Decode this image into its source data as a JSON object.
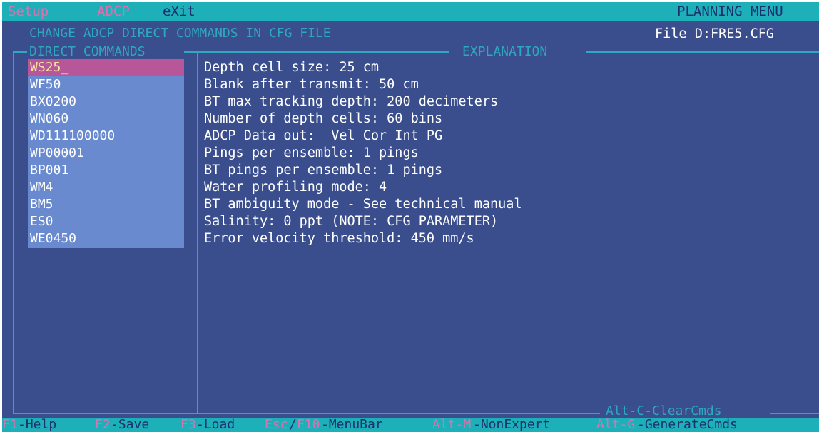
{
  "menu": {
    "setup": "Setup",
    "adcp": "ADCP",
    "exit": "eXit",
    "right_title": "PLANNING MENU"
  },
  "header": {
    "title": "CHANGE ADCP DIRECT COMMANDS IN CFG FILE",
    "file": "File D:FRE5.CFG"
  },
  "panels": {
    "commands_title": "DIRECT COMMANDS",
    "explanation_title": "EXPLANATION",
    "clear_label": "Alt-C-ClearCmds"
  },
  "commands": [
    "WS25_",
    "WF50",
    "BX0200",
    "WN060",
    "WD111100000",
    "WP00001",
    "BP001",
    "WM4",
    "BM5",
    "ES0",
    "WE0450"
  ],
  "explanations": [
    "Depth cell size: 25 cm",
    "Blank after transmit: 50 cm",
    "BT max tracking depth: 200 decimeters",
    "Number of depth cells: 60 bins",
    "ADCP Data out:  Vel Cor Int PG",
    "Pings per ensemble: 1 pings",
    "BT pings per ensemble: 1 pings",
    "Water profiling mode: 4",
    "BT ambiguity mode - See technical manual",
    "Salinity: 0 ppt (NOTE: CFG PARAMETER)",
    "Error velocity threshold: 450 mm/s"
  ],
  "status": {
    "f1_key": "F1",
    "f1_label": "-Help",
    "f2_key": "F2",
    "f2_label": "-Save",
    "f3_key": "F3",
    "f3_label": "-Load",
    "esc_key": "Esc",
    "slash": "/",
    "f10_key": "F10",
    "esc_label": "-MenuBar",
    "altm_key": "Alt-M",
    "altm_label": "-NonExpert",
    "altg_key": "Alt-G",
    "altg_label": "-GenerateCmds"
  },
  "colors": {
    "background": "#3a4d8c",
    "bar": "#1eb0b8",
    "list": "#6a8ad0",
    "selection": "#b8569a",
    "accent_text": "#2fa8bf",
    "hotkey": "#e06fb0"
  }
}
